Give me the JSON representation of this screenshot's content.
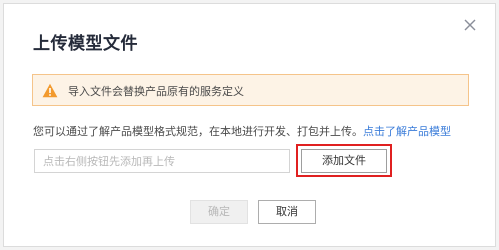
{
  "dialog": {
    "title": "上传模型文件",
    "close_icon": "close-icon"
  },
  "warning": {
    "icon": "warning-triangle-icon",
    "text": "导入文件会替换产品原有的服务定义"
  },
  "description": {
    "text": "您可以通过了解产品模型格式规范，在本地进行开发、打包并上传。",
    "link": "点击了解产品模型"
  },
  "upload": {
    "placeholder": "点击右侧按钮先添加再上传",
    "value": "",
    "add_button": "添加文件"
  },
  "footer": {
    "confirm": "确定",
    "cancel": "取消"
  },
  "colors": {
    "highlight": "#e02020",
    "warning_bg": "#fdf3e6",
    "warning_border": "#f5c48a",
    "warning_icon": "#f29a2e",
    "link": "#3a7cd9"
  }
}
